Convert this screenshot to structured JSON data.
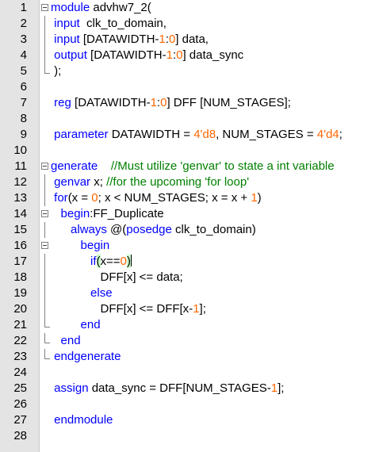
{
  "editor": {
    "lines": [
      {
        "num": "1",
        "fold": "box",
        "tokens": [
          {
            "t": "kw",
            "v": "module"
          },
          {
            "t": "tx",
            "v": " advhw7_2("
          }
        ]
      },
      {
        "num": "2",
        "fold": "bar",
        "tokens": [
          {
            "t": "tx",
            "v": " "
          },
          {
            "t": "kw",
            "v": "input"
          },
          {
            "t": "tx",
            "v": "  clk_to_domain,"
          }
        ]
      },
      {
        "num": "3",
        "fold": "bar",
        "tokens": [
          {
            "t": "tx",
            "v": " "
          },
          {
            "t": "kw",
            "v": "input"
          },
          {
            "t": "tx",
            "v": " [DATAWIDTH-"
          },
          {
            "t": "num",
            "v": "1"
          },
          {
            "t": "tx",
            "v": ":"
          },
          {
            "t": "num",
            "v": "0"
          },
          {
            "t": "tx",
            "v": "] data,"
          }
        ]
      },
      {
        "num": "4",
        "fold": "bar",
        "tokens": [
          {
            "t": "tx",
            "v": " "
          },
          {
            "t": "kw",
            "v": "output"
          },
          {
            "t": "tx",
            "v": " [DATAWIDTH-"
          },
          {
            "t": "num",
            "v": "1"
          },
          {
            "t": "tx",
            "v": ":"
          },
          {
            "t": "num",
            "v": "0"
          },
          {
            "t": "tx",
            "v": "] data_sync"
          }
        ]
      },
      {
        "num": "5",
        "fold": "end",
        "tokens": [
          {
            "t": "tx",
            "v": " );"
          }
        ]
      },
      {
        "num": "6",
        "fold": "",
        "tokens": []
      },
      {
        "num": "7",
        "fold": "",
        "tokens": [
          {
            "t": "tx",
            "v": " "
          },
          {
            "t": "kw",
            "v": "reg"
          },
          {
            "t": "tx",
            "v": " [DATAWIDTH-"
          },
          {
            "t": "num",
            "v": "1"
          },
          {
            "t": "tx",
            "v": ":"
          },
          {
            "t": "num",
            "v": "0"
          },
          {
            "t": "tx",
            "v": "] DFF [NUM_STAGES];"
          }
        ]
      },
      {
        "num": "8",
        "fold": "",
        "tokens": []
      },
      {
        "num": "9",
        "fold": "",
        "tokens": [
          {
            "t": "tx",
            "v": " "
          },
          {
            "t": "kw",
            "v": "parameter"
          },
          {
            "t": "tx",
            "v": " DATAWIDTH = "
          },
          {
            "t": "num",
            "v": "4'd8"
          },
          {
            "t": "tx",
            "v": ", NUM_STAGES = "
          },
          {
            "t": "num",
            "v": "4'd4"
          },
          {
            "t": "tx",
            "v": ";"
          }
        ]
      },
      {
        "num": "10",
        "fold": "",
        "tokens": []
      },
      {
        "num": "11",
        "fold": "box",
        "tokens": [
          {
            "t": "kw",
            "v": "generate"
          },
          {
            "t": "tx",
            "v": "    "
          },
          {
            "t": "cm",
            "v": "//Must utilize 'genvar' to state a int variable"
          }
        ]
      },
      {
        "num": "12",
        "fold": "bar",
        "tokens": [
          {
            "t": "tx",
            "v": " "
          },
          {
            "t": "kw",
            "v": "genvar"
          },
          {
            "t": "tx",
            "v": " x; "
          },
          {
            "t": "cm",
            "v": "//for the upcoming 'for loop'"
          }
        ]
      },
      {
        "num": "13",
        "fold": "bar",
        "tokens": [
          {
            "t": "tx",
            "v": " "
          },
          {
            "t": "kw",
            "v": "for"
          },
          {
            "t": "tx",
            "v": "(x = "
          },
          {
            "t": "num",
            "v": "0"
          },
          {
            "t": "tx",
            "v": "; x < NUM_STAGES; x = x + "
          },
          {
            "t": "num",
            "v": "1"
          },
          {
            "t": "tx",
            "v": ")"
          }
        ]
      },
      {
        "num": "14",
        "fold": "box",
        "tokens": [
          {
            "t": "tx",
            "v": "   "
          },
          {
            "t": "kw",
            "v": "begin"
          },
          {
            "t": "tx",
            "v": ":FF_Duplicate"
          }
        ]
      },
      {
        "num": "15",
        "fold": "bar",
        "tokens": [
          {
            "t": "tx",
            "v": "      "
          },
          {
            "t": "kw",
            "v": "always"
          },
          {
            "t": "tx",
            "v": " @("
          },
          {
            "t": "kw",
            "v": "posedge"
          },
          {
            "t": "tx",
            "v": " clk_to_domain)"
          }
        ]
      },
      {
        "num": "16",
        "fold": "box",
        "tokens": [
          {
            "t": "tx",
            "v": "         "
          },
          {
            "t": "kw",
            "v": "begin"
          }
        ]
      },
      {
        "num": "17",
        "fold": "bar",
        "tokens": [
          {
            "t": "tx",
            "v": "            "
          },
          {
            "t": "kw",
            "v": "if"
          },
          {
            "t": "hl",
            "v": "("
          },
          {
            "t": "tx",
            "v": "x=="
          },
          {
            "t": "num",
            "v": "0"
          },
          {
            "t": "hl",
            "v": ")"
          },
          {
            "t": "caret",
            "v": ""
          }
        ]
      },
      {
        "num": "18",
        "fold": "bar",
        "tokens": [
          {
            "t": "tx",
            "v": "               DFF[x] <= data;"
          }
        ]
      },
      {
        "num": "19",
        "fold": "bar",
        "tokens": [
          {
            "t": "tx",
            "v": "            "
          },
          {
            "t": "kw",
            "v": "else"
          }
        ]
      },
      {
        "num": "20",
        "fold": "bar",
        "tokens": [
          {
            "t": "tx",
            "v": "               DFF[x] <= DFF[x-"
          },
          {
            "t": "num",
            "v": "1"
          },
          {
            "t": "tx",
            "v": "];"
          }
        ]
      },
      {
        "num": "21",
        "fold": "end",
        "tokens": [
          {
            "t": "tx",
            "v": "         "
          },
          {
            "t": "kw",
            "v": "end"
          }
        ]
      },
      {
        "num": "22",
        "fold": "end",
        "tokens": [
          {
            "t": "tx",
            "v": "   "
          },
          {
            "t": "kw",
            "v": "end"
          }
        ]
      },
      {
        "num": "23",
        "fold": "end",
        "tokens": [
          {
            "t": "tx",
            "v": " "
          },
          {
            "t": "kw",
            "v": "endgenerate"
          }
        ]
      },
      {
        "num": "24",
        "fold": "",
        "tokens": []
      },
      {
        "num": "25",
        "fold": "",
        "tokens": [
          {
            "t": "tx",
            "v": " "
          },
          {
            "t": "kw",
            "v": "assign"
          },
          {
            "t": "tx",
            "v": " data_sync = DFF[NUM_STAGES-"
          },
          {
            "t": "num",
            "v": "1"
          },
          {
            "t": "tx",
            "v": "];"
          }
        ]
      },
      {
        "num": "26",
        "fold": "",
        "tokens": []
      },
      {
        "num": "27",
        "fold": "",
        "tokens": [
          {
            "t": "tx",
            "v": " "
          },
          {
            "t": "kw",
            "v": "endmodule"
          }
        ]
      },
      {
        "num": "28",
        "fold": "",
        "tokens": []
      }
    ]
  },
  "colors": {
    "keyword": "#0000ff",
    "number": "#ff6600",
    "comment": "#008000",
    "gutter": "#e4e4e4"
  }
}
